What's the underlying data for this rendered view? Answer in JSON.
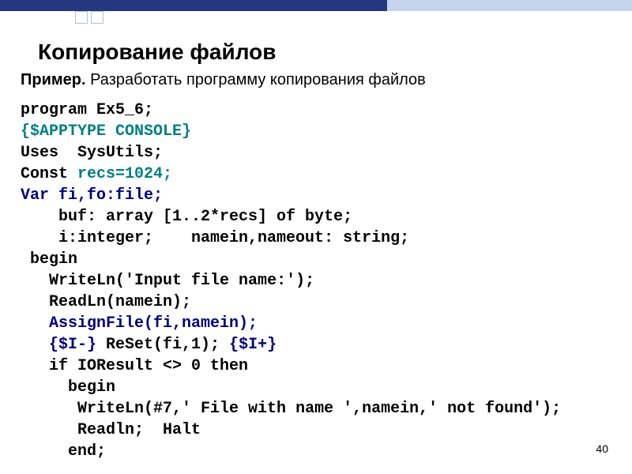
{
  "slide": {
    "title": "Копирование файлов",
    "subtitle_label": "Пример.",
    "subtitle_text": " Разработать программу копирования файлов",
    "page_number": "40"
  },
  "code": {
    "l1_program": "program ",
    "l1_name": "Ex5_6;",
    "l2": "{$APPTYPE CONSOLE}",
    "l3_uses": "Uses  ",
    "l3_rest": "SysUtils;",
    "l4_const": "Const ",
    "l4_recs": "recs=1024;",
    "l5_var": "Var ",
    "l5_rest": "fi,fo:file;",
    "l6": "    buf: array [1..2*recs] of byte;",
    "l7": "    i:integer;    namein,nameout: string;",
    "l8": " begin",
    "l9_ind": "   WriteLn",
    "l9_args": "('Input file name:');",
    "l10_ind": "   ReadLn",
    "l10_args": "(namein);",
    "l11_ind": "   ",
    "l11_call": "AssignFile(fi,namein);",
    "l12_ind": "   ",
    "l12_d1": "{$I-} ",
    "l12_reset": "ReSet(fi,1); ",
    "l12_d2": "{$I+}",
    "l13_ind": "   if ",
    "l13_io": "IOResult",
    "l13_cmp": " <> 0 then",
    "l14": "     begin",
    "l15_ind": "      WriteLn",
    "l15_args": "(#7,' File with name ',namein,' not found');",
    "l16": "      Readln;  Halt",
    "l17": "     end;"
  }
}
